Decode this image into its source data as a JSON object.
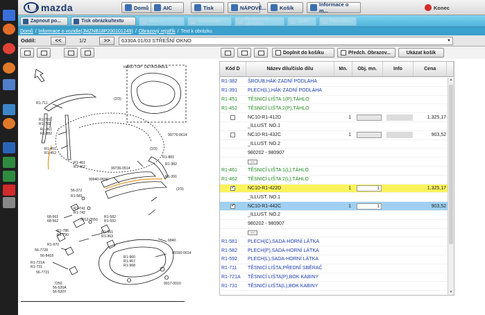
{
  "header": {
    "logo_text": "mazda",
    "buttons": [
      {
        "label": "Domů",
        "icon": "home-icon"
      },
      {
        "label": "AIC",
        "icon": "info-icon"
      },
      {
        "label": "Tisk",
        "icon": "printer-icon"
      },
      {
        "label": "NÁPOVĚ...",
        "icon": "help-icon"
      },
      {
        "label": "Košík",
        "icon": "cart-icon"
      },
      {
        "label": "Informace o m...",
        "icon": "info-screen-icon"
      },
      {
        "label": "Konec",
        "icon": "exit-icon"
      }
    ]
  },
  "toolbar2": {
    "buttons": [
      {
        "label": "Zapnout po...",
        "enabled": true
      },
      {
        "label": "Tisk obrázku/textu",
        "enabled": true
      },
      {
        "label": "Myš...",
        "enabled": false
      },
      {
        "label": "Ilustrační",
        "enabled": false
      },
      {
        "label": "Nastavení obrázku",
        "enabled": false
      },
      {
        "label": "Zpět",
        "enabled": false
      },
      {
        "label": "Poznám...",
        "enabled": false
      }
    ]
  },
  "breadcrumb": {
    "items": [
      "Domů",
      "Informace o vozidle(JMZNB18P200101249)",
      "Obrazový rejstřík",
      "Text k obrázku"
    ],
    "separator": "/"
  },
  "nav": {
    "label": "Oddíl:",
    "prev": "<<",
    "page": "1/2",
    "next": ">>",
    "image_select": "6330A 01/03 STŘEŠNÍ OKNO"
  },
  "tools": {
    "add_to_cart": "Doplnit do košíku",
    "prev_image": "Předch. Obrazov...",
    "show_cart": "Ukázat košík"
  },
  "table": {
    "columns": [
      "Kód D",
      "Název dílu/číslo dílu",
      "Mn.",
      "Obj. mn.",
      "Info",
      "Cena"
    ],
    "rows": [
      {
        "type": "blue",
        "code": "R1-382",
        "name": "ŠROUB,HÁK-ZADNÍ PODLAHA"
      },
      {
        "type": "blue",
        "code": "R1-391",
        "name": "PLECH(L),HÁK-ZADNÍ PODLAHA"
      },
      {
        "type": "green",
        "code": "R1-451",
        "name": "TĚSNICÍ LIŠTA 1(P),TÁHLO"
      },
      {
        "type": "green",
        "code": "R1-452",
        "name": "TĚSNICÍ LIŠTA 2(P),TÁHLO"
      },
      {
        "type": "part",
        "checked": false,
        "name": "NC10-R1-412D",
        "qty": "1",
        "order": "",
        "price": "1.325,17"
      },
      {
        "type": "text",
        "name": "_ILLUST. NO.1"
      },
      {
        "type": "part",
        "checked": false,
        "name": "NC10-R1-432C",
        "qty": "1",
        "order": "",
        "price": "903,52"
      },
      {
        "type": "text",
        "name": "_ILLUST. NO.2"
      },
      {
        "type": "text",
        "name": "980202 - 980907"
      },
      {
        "type": "dots"
      },
      {
        "type": "green",
        "code": "R1-461",
        "name": "TĚSNICÍ LIŠTA 1(L),TÁHLO"
      },
      {
        "type": "green",
        "code": "R1-462",
        "name": "TĚSNICÍ LIŠTA 2(L),TÁHLO"
      },
      {
        "type": "part",
        "highlight": "yellow",
        "checked": true,
        "name": "NC10-R1-422D",
        "qty": "1",
        "order": "1",
        "price": "1.325,17"
      },
      {
        "type": "text",
        "name": "_ILLUST. NO.1"
      },
      {
        "type": "part",
        "highlight": "blue",
        "checked": true,
        "name": "NC10-R1-442C",
        "qty": "1",
        "order": "1",
        "price": "903,52"
      },
      {
        "type": "text",
        "name": "_ILLUST. NO.2"
      },
      {
        "type": "text",
        "name": "980202 - 980907"
      },
      {
        "type": "dots"
      },
      {
        "type": "blue",
        "code": "R1-581",
        "name": "PLECH(C),SADA-HORNÍ LÁTKA"
      },
      {
        "type": "blue",
        "code": "R1-582",
        "name": "PLECH(P),SADA-HORNÍ LÁTKA"
      },
      {
        "type": "blue",
        "code": "R1-592",
        "name": "PLECH(L),SADA-HORNÍ LÁTKA"
      },
      {
        "type": "blue",
        "code": "R1-711",
        "name": "TĚSNICÍ LIŠTA,PŘEDNÍ SBĚRAČ"
      },
      {
        "type": "blue",
        "code": "R1-721A",
        "name": "TĚSNICÍ LIŠTA(P),BOK KABINY"
      },
      {
        "type": "blue",
        "code": "R1-731",
        "name": "TĚSNICÍ LIŠTA(L),BOK KABINY"
      }
    ]
  },
  "diagram": {
    "labels": [
      "(2/3)",
      "(2/3)",
      "(2/3)",
      "R1-711",
      "R1-781",
      "R1-782",
      "R1-861",
      "R1-882",
      "R1-451",
      "R1-452",
      "R1-461",
      "R1-462",
      "R1-881",
      "R1-382",
      "R1-391",
      "R1-581",
      "R1-582",
      "R1-592",
      "R1-721A",
      "R1-731",
      "R1-741",
      "R1-742",
      "R1-361",
      "R1-363",
      "R1-786",
      "R1-790",
      "R1-960",
      "R1-967",
      "R1-968",
      "6840",
      "7250",
      "99776-0614",
      "99736-0514",
      "99940-0600",
      "56-372",
      "56-7728",
      "56-8418",
      "56-7721",
      "56-520A",
      "56-520Y",
      "68-561",
      "68-562",
      "R1-970",
      "09160-0614",
      "9912-0550",
      "9917-0010",
      "HARD TOP",
      "DETACHABLE"
    ],
    "colors": {
      "ink": "#1a1a1a",
      "highlight": "#e8a23c"
    }
  },
  "colors": {
    "topbar": "#d9d9d9",
    "toolbar2": "#4fb4db",
    "breadcrumb": "#3aa0cc",
    "blue_text": "#1b3bb0",
    "green_text": "#1e8a1e",
    "highlight_yellow": "#fbf35c",
    "highlight_blue": "#9fd0f1"
  }
}
